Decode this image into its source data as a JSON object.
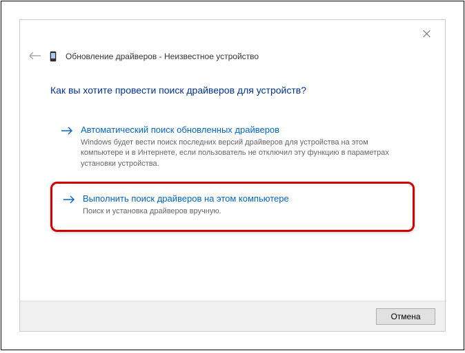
{
  "window": {
    "title": "Обновление драйверов - Неизвестное устройство"
  },
  "question": "Как вы хотите провести поиск драйверов для устройств?",
  "options": {
    "auto": {
      "title": "Автоматический поиск обновленных драйверов",
      "desc": "Windows будет вести поиск последних версий драйверов для устройства на этом компьютере и в Интернете, если пользователь не отключил эту функцию в параметрах установки устройства."
    },
    "manual": {
      "title": "Выполнить поиск драйверов на этом компьютере",
      "desc": "Поиск и установка драйверов вручную."
    }
  },
  "footer": {
    "cancel": "Отмена"
  }
}
